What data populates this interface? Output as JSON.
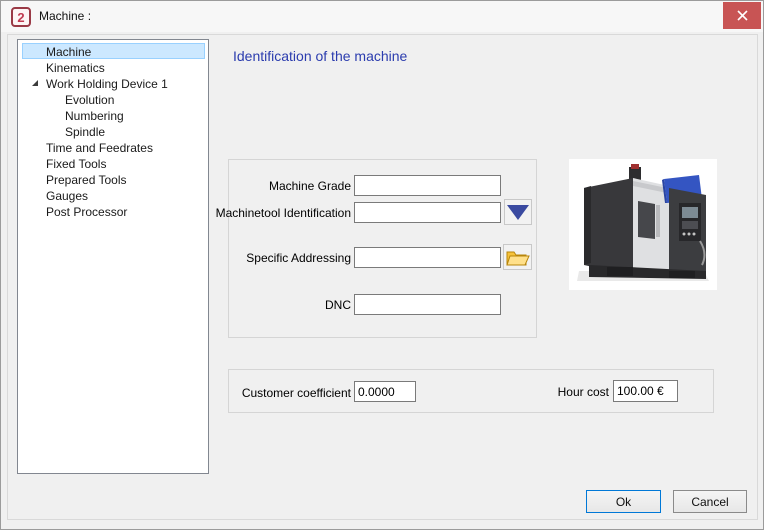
{
  "window": {
    "title": "Machine :",
    "app_icon_glyph": "2"
  },
  "icons": {
    "close": "×",
    "dropdown": "▼",
    "open_folder": "📂",
    "tree_expander": "◢"
  },
  "tree": {
    "items": [
      {
        "label": "Machine",
        "level": 1,
        "selected": true
      },
      {
        "label": "Kinematics",
        "level": 1
      },
      {
        "label": "Work Holding Device 1",
        "level": 1,
        "expanded": true
      },
      {
        "label": "Evolution",
        "level": 2
      },
      {
        "label": "Numbering",
        "level": 2
      },
      {
        "label": "Spindle",
        "level": 2
      },
      {
        "label": "Time and Feedrates",
        "level": 1
      },
      {
        "label": "Fixed Tools",
        "level": 1
      },
      {
        "label": "Prepared Tools",
        "level": 1
      },
      {
        "label": "Gauges",
        "level": 1
      },
      {
        "label": "Post Processor",
        "level": 1
      }
    ]
  },
  "main": {
    "heading": "Identification of the machine",
    "fields": {
      "machine_grade": {
        "label": "Machine Grade",
        "value": ""
      },
      "machinetool_identification": {
        "label": "Machinetool Identification",
        "value": ""
      },
      "specific_addressing": {
        "label": "Specific Addressing",
        "value": ""
      },
      "dnc": {
        "label": "DNC",
        "value": ""
      }
    },
    "costs": {
      "customer_coefficient": {
        "label": "Customer coefficient",
        "value": "0.0000"
      },
      "hour_cost": {
        "label": "Hour cost",
        "value": "100.00 €"
      }
    }
  },
  "footer": {
    "ok_label": "Ok",
    "cancel_label": "Cancel"
  },
  "colors": {
    "heading_blue": "#2b3cae",
    "close_button_red": "#c85454",
    "tree_selection_bg": "#cce8ff",
    "tree_selection_border": "#99d1ff",
    "dropdown_triangle_blue": "#3a4aa0",
    "machine_photo_blue": "#3455c2"
  }
}
